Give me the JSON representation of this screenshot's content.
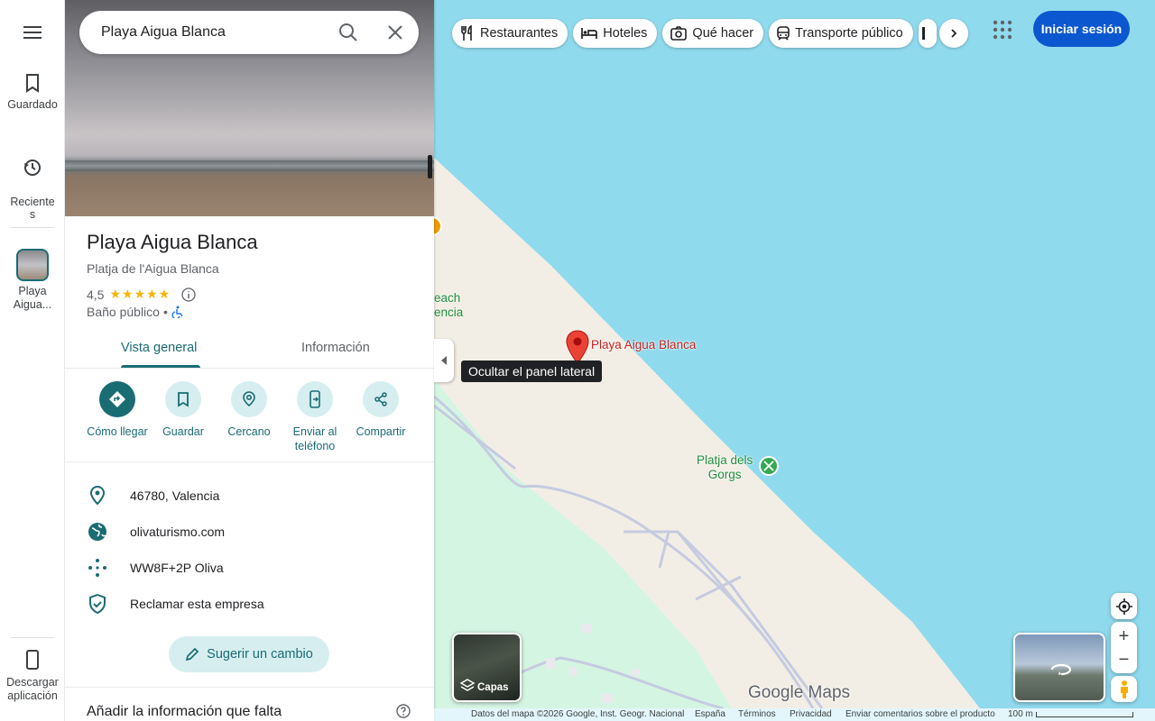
{
  "rail": {
    "menu_icon": "menu-icon",
    "saved_label": "Guardado",
    "recents_label": "Reciente\ns",
    "recent_place_label": "Playa Aigua...",
    "download_label": "Descargar aplicación"
  },
  "search": {
    "value": "Playa Aigua Blanca",
    "search_icon": "search-icon",
    "close_icon": "close-icon"
  },
  "place": {
    "name": "Playa Aigua Blanca",
    "alt_name": "Platja de l'Aigua Blanca",
    "rating": "4,5",
    "stars": "★★★★★",
    "category": "Baño público",
    "separator": "•"
  },
  "tabs": [
    {
      "label": "Vista general",
      "active": true
    },
    {
      "label": "Información",
      "active": false
    }
  ],
  "actions": [
    {
      "label": "Cómo llegar",
      "icon": "directions-icon"
    },
    {
      "label": "Guardar",
      "icon": "bookmark-icon"
    },
    {
      "label": "Cercano",
      "icon": "nearby-icon"
    },
    {
      "label": "Enviar al teléfono",
      "icon": "send-to-phone-icon"
    },
    {
      "label": "Compartir",
      "icon": "share-icon"
    }
  ],
  "info": [
    {
      "text": "46780, Valencia",
      "icon": "location-pin-icon"
    },
    {
      "text": "olivaturismo.com",
      "icon": "globe-icon"
    },
    {
      "text": "WW8F+2P Oliva",
      "icon": "plus-code-icon"
    },
    {
      "text": "Reclamar esta empresa",
      "icon": "verified-shield-icon"
    }
  ],
  "suggest_label": "Sugerir un cambio",
  "missing_info_title": "Añadir la información que falta",
  "chips": [
    {
      "label": "Restaurantes",
      "icon": "restaurant-icon"
    },
    {
      "label": "Hoteles",
      "icon": "hotel-icon"
    },
    {
      "label": "Qué hacer",
      "icon": "camera-icon"
    },
    {
      "label": "Transporte público",
      "icon": "transit-icon"
    }
  ],
  "signin_label": "Iniciar sesión",
  "tooltip": "Ocultar el panel lateral",
  "map": {
    "pin_label": "Playa Aigua Blanca",
    "poi_cut_label": "each\nencia",
    "poi_label": "Platja dels\nGorgs",
    "layers_label": "Capas",
    "logo": "Google Maps",
    "zoom_in": "+",
    "zoom_out": "−"
  },
  "footer": {
    "attribution": "Datos del mapa ©2026 Google, Inst. Geogr. Nacional",
    "country": "España",
    "terms": "Términos",
    "privacy": "Privacidad",
    "feedback": "Enviar comentarios sobre el producto",
    "scale": "100 m"
  },
  "colors": {
    "accent": "#1a6c73",
    "signin": "#0b57d0",
    "water": "#90daee",
    "sand": "#f3eee5",
    "park": "#d5f5e3",
    "pin": "#ea4335"
  }
}
